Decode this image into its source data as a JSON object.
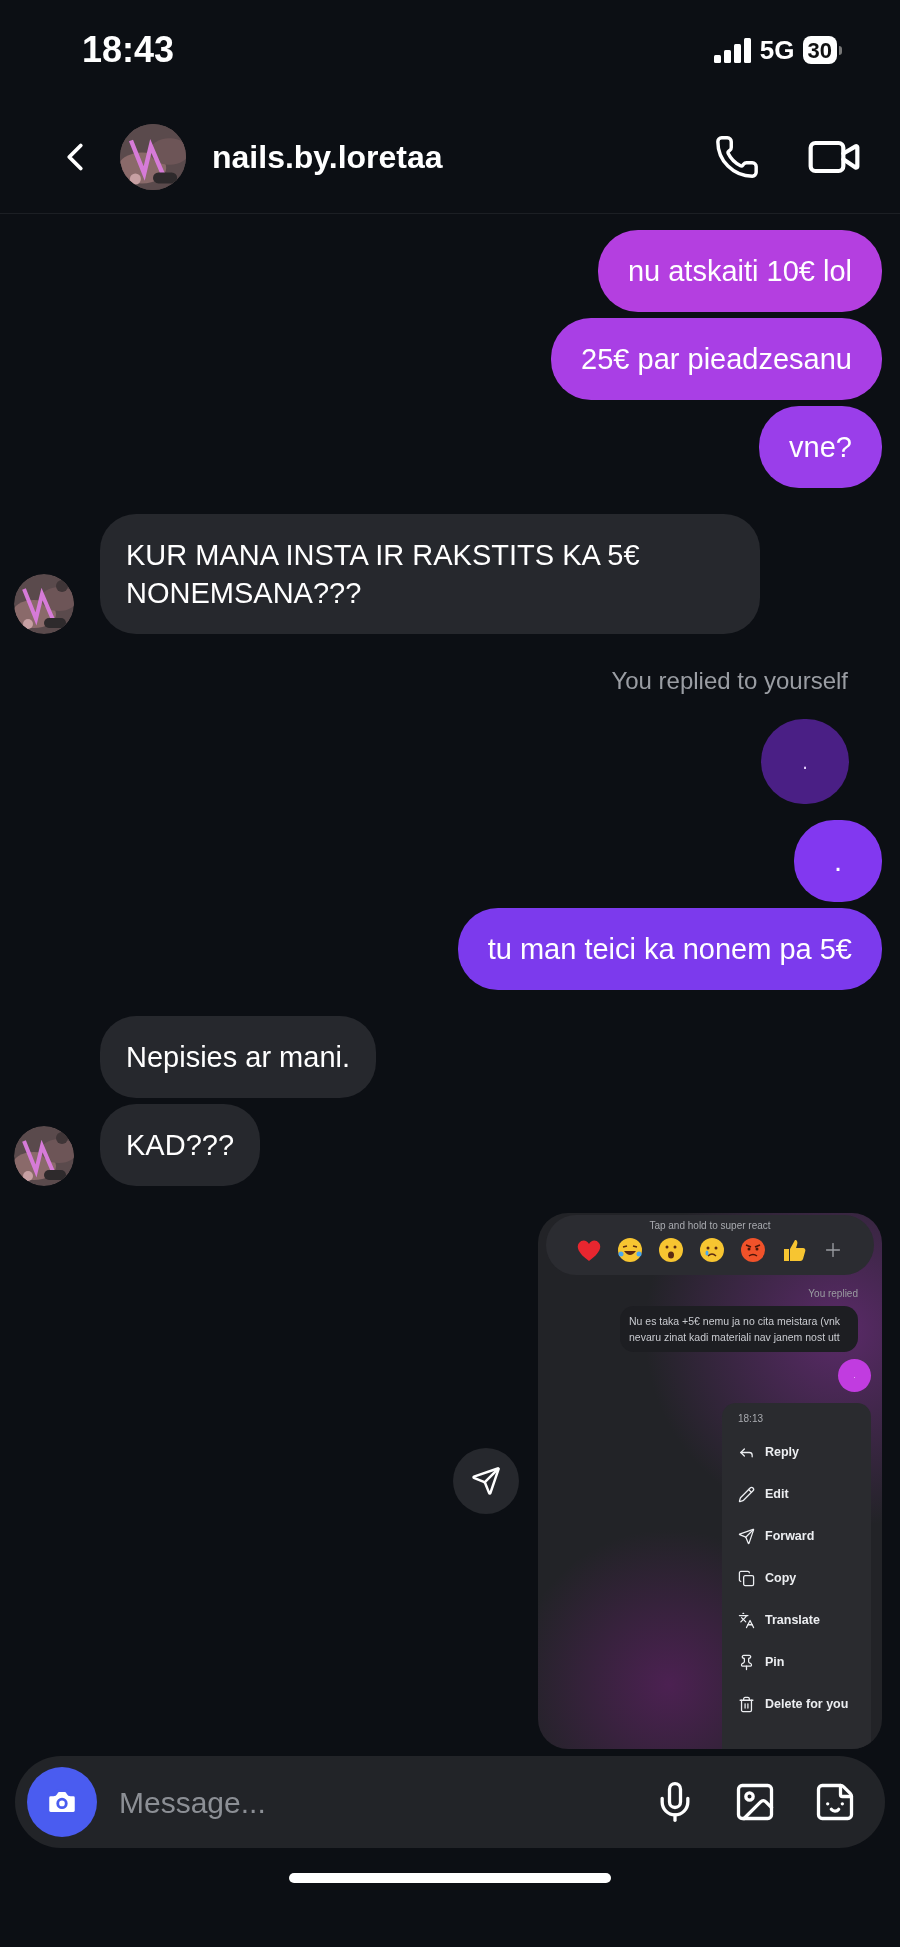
{
  "status_bar": {
    "time": "18:43",
    "network": "5G",
    "battery": "30"
  },
  "header": {
    "contact_name": "nails.by.loretaa"
  },
  "messages": [
    {
      "kind": "sent",
      "text": "nu atskaiti 10€ lol"
    },
    {
      "kind": "sent",
      "text": "25€ par pieadzesanu"
    },
    {
      "kind": "sent",
      "text": "vne?"
    },
    {
      "kind": "received",
      "text": "KUR MANA INSTA IR RAKSTITS KA 5€ NONEMSANA???",
      "show_avatar": true
    },
    {
      "kind": "note",
      "text": "You replied to yourself"
    },
    {
      "kind": "quoted",
      "text": "."
    },
    {
      "kind": "sent",
      "text": "."
    },
    {
      "kind": "sent",
      "text": "tu man teici ka nonem pa 5€"
    },
    {
      "kind": "received",
      "text": "Nepisies ar mani.",
      "show_avatar": false
    },
    {
      "kind": "received",
      "text": "KAD???",
      "show_avatar": true
    }
  ],
  "shared_screenshot": {
    "hint": "Tap and hold to super react",
    "replied_label": "You replied",
    "quoted_text": "Nu es taka +5€ nemu ja no cita meistara (vnk nevaru zinat kadi materiali nav janem nost utt",
    "dot_text": ".",
    "menu": {
      "time": "18:13",
      "items": [
        {
          "label": "Reply",
          "kind": "reply"
        },
        {
          "label": "Edit",
          "kind": "edit"
        },
        {
          "label": "Forward",
          "kind": "forward"
        },
        {
          "label": "Copy",
          "kind": "copy"
        },
        {
          "label": "Translate",
          "kind": "translate"
        },
        {
          "label": "Pin",
          "kind": "pin"
        },
        {
          "label": "Delete for you",
          "kind": "delete"
        }
      ]
    }
  },
  "composer": {
    "placeholder": "Message..."
  }
}
